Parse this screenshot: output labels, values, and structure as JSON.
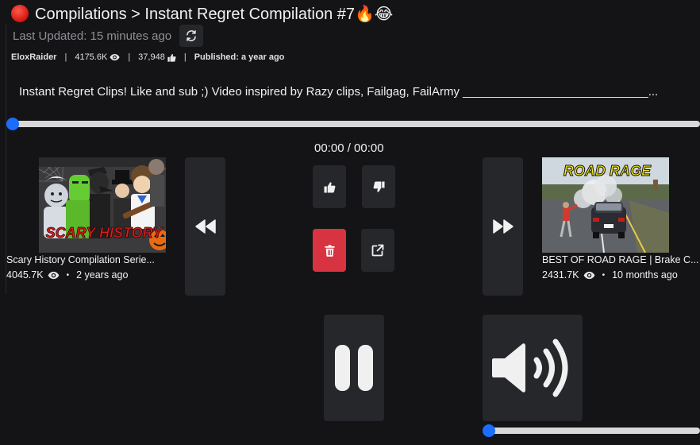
{
  "header": {
    "title": "Compilations > Instant Regret Compilation #7🔥😂",
    "last_updated": "Last Updated: 15 minutes ago"
  },
  "meta": {
    "channel": "EloxRaider",
    "views": "4175.6K",
    "likes": "37,948",
    "published": "Published: a year ago"
  },
  "description": "Instant Regret Clips! Like and sub ;) Video inspired by Razy clips, Failgag, FailArmy ____________________________...",
  "player": {
    "time": "00:00 / 00:00",
    "progress": 0,
    "volume": 0
  },
  "previous_video": {
    "title": "Scary History Compilation Serie...",
    "views": "4045.7K",
    "age": "2 years ago",
    "thumbnail_text": "SCARY HISTORY"
  },
  "next_video": {
    "title": "BEST OF ROAD RAGE | Brake C...",
    "views": "2431.7K",
    "age": "10 months ago",
    "thumbnail_text": "ROAD RAGE"
  },
  "separators": {
    "pipe": "|",
    "bullet": "•"
  },
  "colors": {
    "accent": "#1a6dff",
    "danger": "#d73340",
    "button_bg": "#26272b"
  }
}
